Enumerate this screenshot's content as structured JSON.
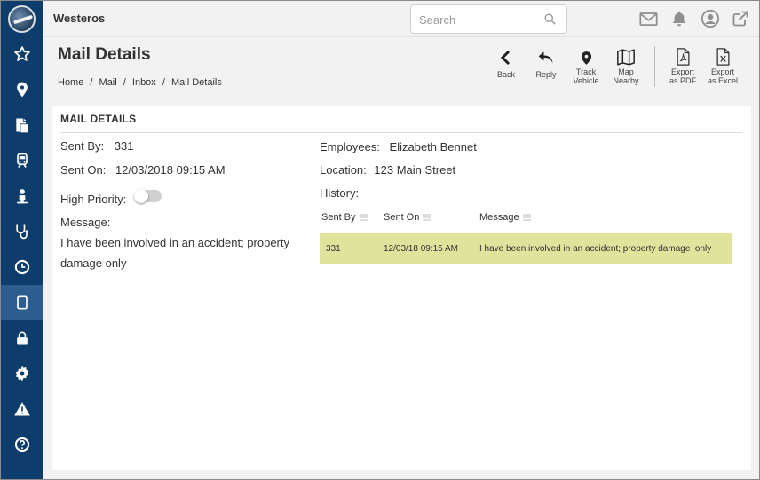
{
  "app": {
    "title": "Westeros"
  },
  "search": {
    "placeholder": "Search",
    "value": ""
  },
  "sidebar": {
    "items": [
      {
        "icon": "star-icon"
      },
      {
        "icon": "location-pin-icon"
      },
      {
        "icon": "documents-icon"
      },
      {
        "icon": "train-icon"
      },
      {
        "icon": "person-icon"
      },
      {
        "icon": "stethoscope-icon"
      },
      {
        "icon": "clock-icon"
      },
      {
        "icon": "tablet-icon",
        "active": true
      },
      {
        "icon": "lock-icon"
      },
      {
        "icon": "gear-icon"
      },
      {
        "icon": "warning-icon"
      },
      {
        "icon": "help-icon"
      }
    ]
  },
  "topbar_icons": [
    "mail-icon",
    "bell-icon",
    "user-icon",
    "external-link-icon"
  ],
  "page": {
    "title": "Mail Details",
    "breadcrumb": [
      "Home",
      "Mail",
      "Inbox",
      "Mail Details"
    ],
    "breadcrumb_sep": "/"
  },
  "toolbar": {
    "back": "Back",
    "reply": "Reply",
    "track_vehicle_1": "Track",
    "track_vehicle_2": "Vehicle",
    "map_nearby_1": "Map",
    "map_nearby_2": "Nearby",
    "export_pdf_1": "Export",
    "export_pdf_2": "as PDF",
    "export_excel_1": "Export",
    "export_excel_2": "as Excel"
  },
  "details": {
    "section_title": "MAIL DETAILS",
    "sent_by_label": "Sent By:",
    "sent_by_value": "331",
    "sent_on_label": "Sent On:",
    "sent_on_value": "12/03/2018 09:15 AM",
    "high_priority_label": "High Priority:",
    "high_priority_on": false,
    "message_label": "Message:",
    "message_value": "I have been involved in an accident; property damage only",
    "employees_label": "Employees:",
    "employees_value": "Elizabeth Bennet",
    "location_label": "Location:",
    "location_value": "123 Main Street",
    "history_label": "History:"
  },
  "history": {
    "columns": [
      "Sent By",
      "Sent On",
      "Message"
    ],
    "rows": [
      {
        "sent_by": "331",
        "sent_on": "12/03/18 09:15 AM",
        "message": "I have been involved in an accident; property damage  only"
      }
    ],
    "row_highlight": "#dfe39b"
  },
  "colors": {
    "sidebar": "#0f3d6b",
    "sidebar_active": "#2c5d8e"
  }
}
